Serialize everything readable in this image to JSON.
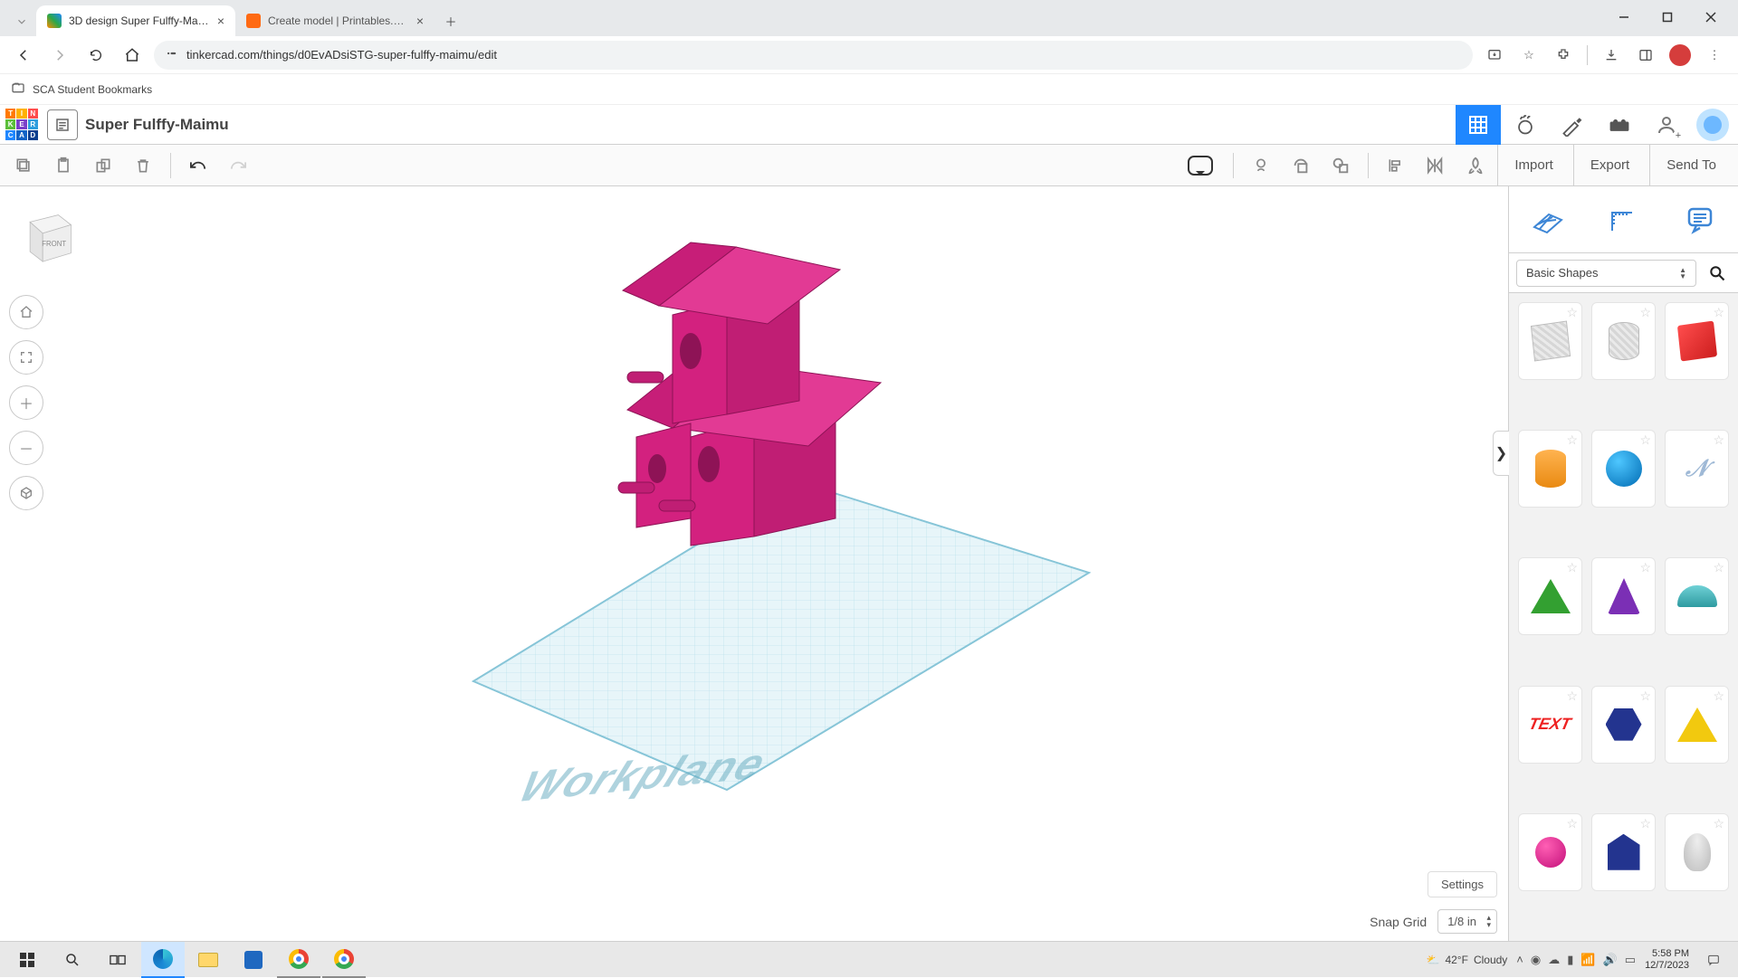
{
  "browser": {
    "tabs": [
      {
        "title": "3D design Super Fulffy-Maimu |",
        "active": true,
        "favicon": "#ff8a00"
      },
      {
        "title": "Create model | Printables.com",
        "active": false,
        "favicon": "#ff6a13"
      }
    ],
    "url": "tinkercad.com/things/d0EvADsiSTG-super-fulffy-maimu/edit",
    "bookmark": "SCA Student Bookmarks"
  },
  "app": {
    "title": "Super Fulffy-Maimu",
    "actions": {
      "import": "Import",
      "export": "Export",
      "sendto": "Send To"
    },
    "settings_label": "Settings",
    "snap": {
      "label": "Snap Grid",
      "value": "1/8 in"
    },
    "workplane_label": "Workplane",
    "viewcube_face": "FRONT",
    "shapes_category": "Basic Shapes"
  },
  "taskbar": {
    "weather_temp": "42°F",
    "weather_cond": "Cloudy",
    "time": "5:58 PM",
    "date": "12/7/2023"
  }
}
